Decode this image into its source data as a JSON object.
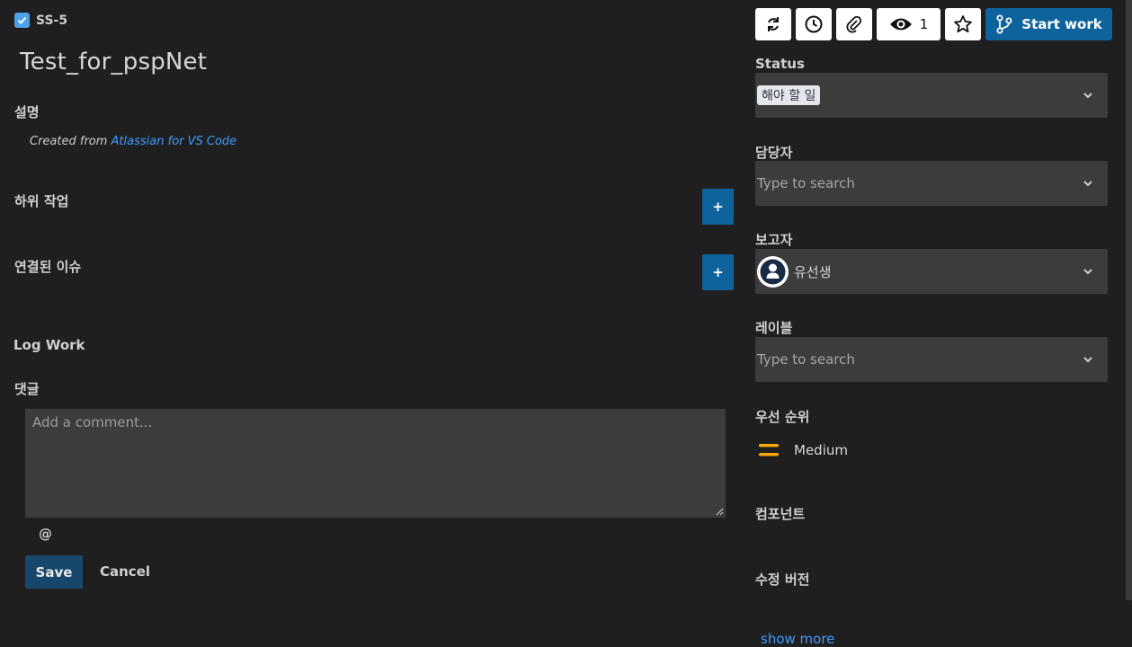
{
  "issue": {
    "key": "SS-5",
    "summary": "Test_for_pspNet"
  },
  "description": {
    "heading": "설명",
    "prefix": "Created from ",
    "link": "Atlassian for VS Code"
  },
  "subtasks": {
    "heading": "하위 작업",
    "add_label": "+"
  },
  "linked": {
    "heading": "연결된 이슈",
    "add_label": "+"
  },
  "log_work": {
    "heading": "Log Work"
  },
  "comments": {
    "heading": "댓글",
    "placeholder": "Add a comment...",
    "mention": "@",
    "save_label": "Save",
    "cancel_label": "Cancel"
  },
  "toolbar": {
    "watchers_count": "1",
    "start_work_label": "Start work",
    "icons": [
      "refresh-icon",
      "clock-icon",
      "paperclip-icon",
      "eye-icon",
      "star-icon",
      "branch-icon"
    ]
  },
  "fields": {
    "status": {
      "label": "Status",
      "value": "해야 할 일"
    },
    "assignee": {
      "label": "담당자",
      "placeholder": "Type to search"
    },
    "reporter": {
      "label": "보고자",
      "value": "유선생"
    },
    "labels": {
      "label": "레이블",
      "placeholder": "Type to search"
    },
    "priority": {
      "label": "우선 순위",
      "value": "Medium",
      "color": "#ffab00"
    },
    "components": {
      "label": "컴포넌트"
    },
    "fix_versions": {
      "label": "수정 버전"
    }
  },
  "show_more": "show more",
  "colors": {
    "background": "#1f1f1f",
    "accent": "#0e639c",
    "link": "#3f9bff",
    "input": "#3c3c3c"
  }
}
